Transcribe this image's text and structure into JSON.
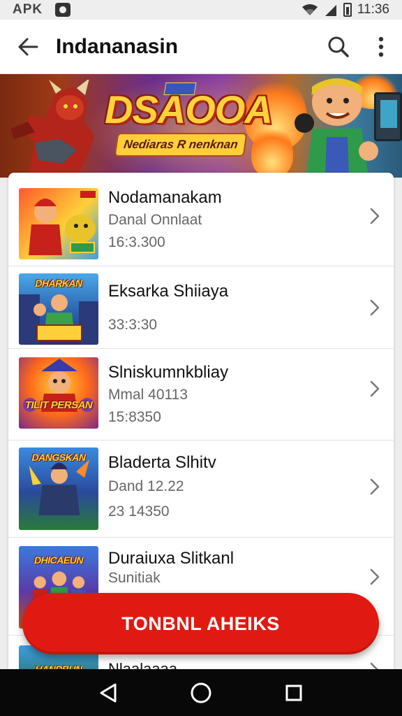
{
  "status_bar": {
    "app_label": "APK",
    "time": "11:36"
  },
  "app_bar": {
    "title": "Indananasin",
    "back_icon": "arrow-back-icon",
    "search_icon": "search-icon",
    "more_icon": "more-vert-icon"
  },
  "banner": {
    "title": "DSAOOA",
    "subtitle": "Nediaras R nenknan"
  },
  "items": [
    {
      "thumb_title": "",
      "title": "Nodamanakam",
      "subtitle": "Danal Onnlaat",
      "time": "16:3.300"
    },
    {
      "thumb_title": "DHARKAN",
      "title": "Eksarka Shiiaya",
      "subtitle": "",
      "time": "33:3:30"
    },
    {
      "thumb_title": "TILIT PERSAN",
      "title": "Slniskumnkbliay",
      "subtitle": "Mmal 40113",
      "time": "15:8350"
    },
    {
      "thumb_title": "DANGSKAN",
      "title": "Bladerta Slhitv",
      "subtitle": "Dand 12.22",
      "time": "23 14350"
    },
    {
      "thumb_title": "DHICAEUN",
      "title": "Duraiuxa Slitkanl",
      "subtitle": "Sunitiak",
      "time": ""
    }
  ],
  "peek_item": {
    "thumb_title": "HANDBUN",
    "title": "Nlaalaaaa"
  },
  "cta": {
    "label": "TONBNL AHEIKS"
  },
  "colors": {
    "accent": "#e01a12",
    "banner_title": "#ffd23c"
  }
}
